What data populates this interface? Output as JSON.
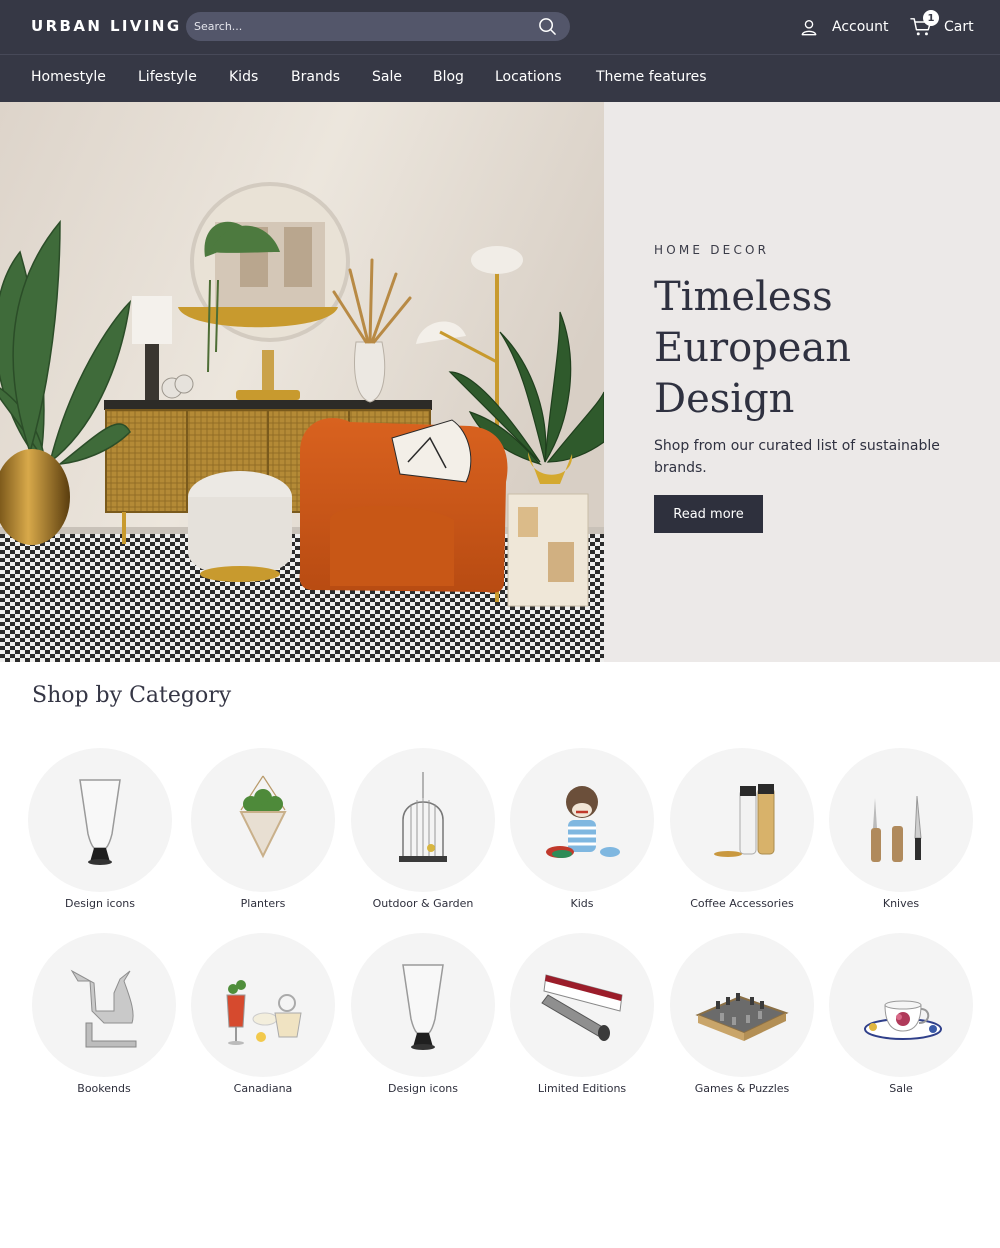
{
  "header": {
    "logo": "URBAN LIVING",
    "search_placeholder": "Search...",
    "account_label": "Account",
    "cart_label": "Cart",
    "cart_count": "1"
  },
  "nav": {
    "items": [
      "Homestyle",
      "Lifestyle",
      "Kids",
      "Brands",
      "Sale",
      "Blog",
      "Locations",
      "Theme features"
    ]
  },
  "hero": {
    "eyebrow": "HOME DECOR",
    "title_lines": [
      "Timeless",
      "European",
      "Design"
    ],
    "text": "Shop from our curated list of sustainable brands.",
    "button": "Read more"
  },
  "categories": {
    "title": "Shop by Category",
    "items": [
      {
        "label": "Design icons",
        "icon": "glass-vase-icon"
      },
      {
        "label": "Planters",
        "icon": "hanging-planter-icon"
      },
      {
        "label": "Outdoor & Garden",
        "icon": "birdcage-icon"
      },
      {
        "label": "Kids",
        "icon": "sock-monkey-icon"
      },
      {
        "label": "Coffee Accessories",
        "icon": "coffee-grinder-icon"
      },
      {
        "label": "Knives",
        "icon": "knives-icon"
      },
      {
        "label": "Bookends",
        "icon": "cat-bookend-icon"
      },
      {
        "label": "Canadiana",
        "icon": "cocktail-glasses-icon"
      },
      {
        "label": "Design icons",
        "icon": "glass-vase-icon"
      },
      {
        "label": "Limited Editions",
        "icon": "tube-opener-icon"
      },
      {
        "label": "Games & Puzzles",
        "icon": "chess-set-icon"
      },
      {
        "label": "Sale",
        "icon": "teacup-icon"
      }
    ]
  },
  "colors": {
    "header_bg": "#363845",
    "hero_panel_bg": "#ece9e8",
    "button_bg": "#2e303d",
    "category_circle_bg": "#f4f4f4"
  }
}
